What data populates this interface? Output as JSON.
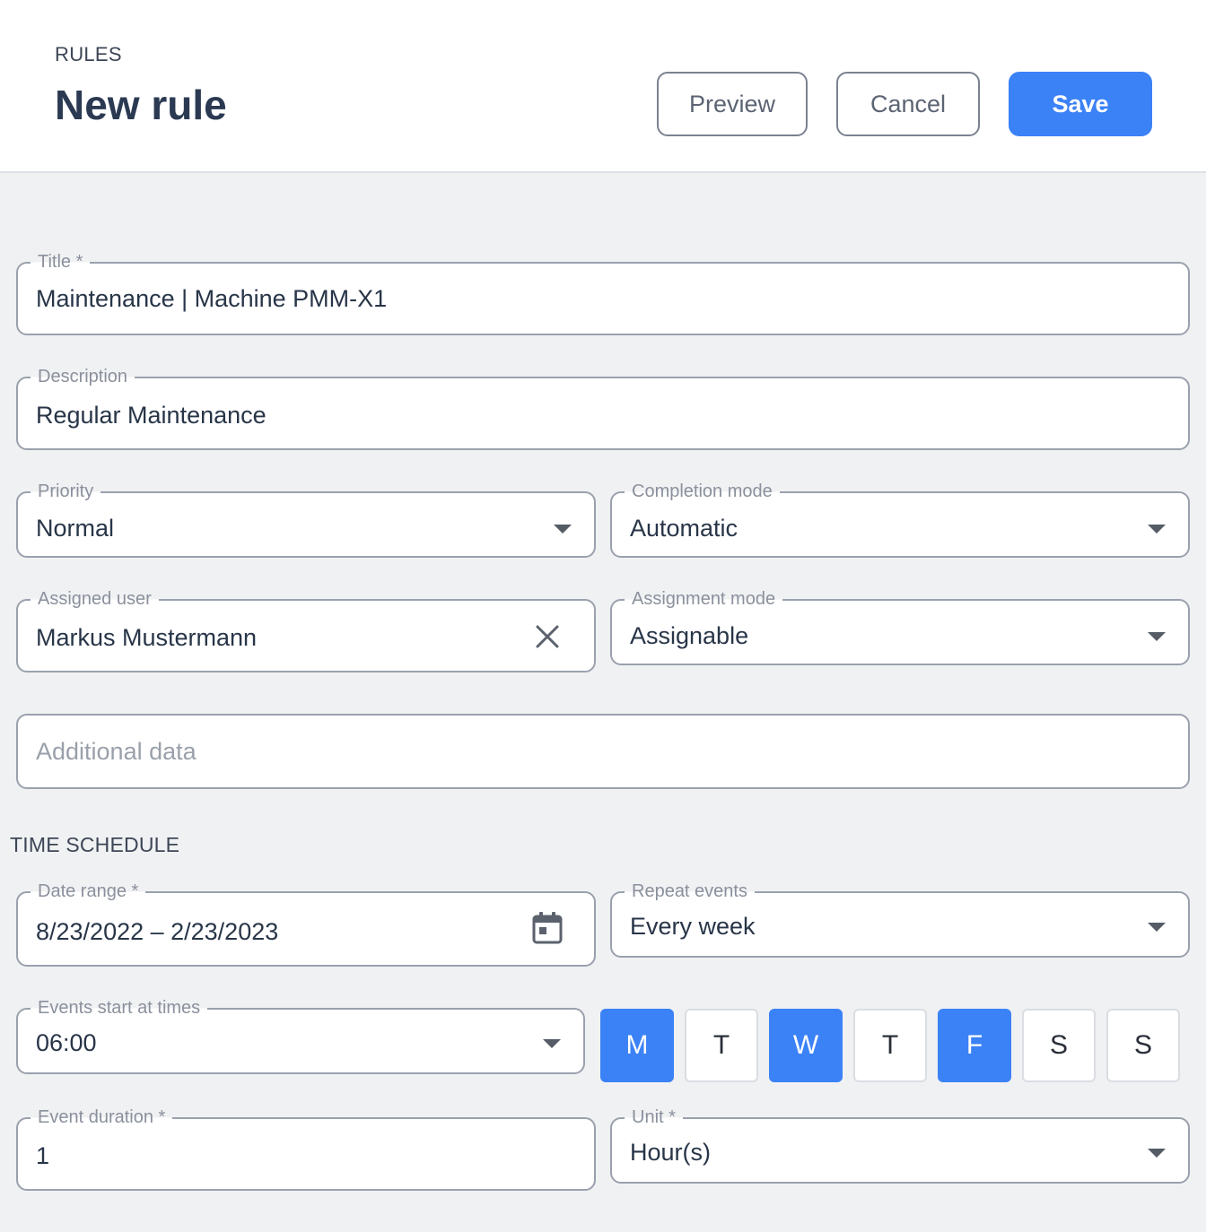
{
  "header": {
    "breadcrumb": "RULES",
    "title": "New rule",
    "preview_label": "Preview",
    "cancel_label": "Cancel",
    "save_label": "Save"
  },
  "form": {
    "title": {
      "label": "Title *",
      "value": "Maintenance | Machine PMM-X1"
    },
    "description": {
      "label": "Description",
      "value": "Regular Maintenance"
    },
    "priority": {
      "label": "Priority",
      "value": "Normal"
    },
    "completion_mode": {
      "label": "Completion mode",
      "value": "Automatic"
    },
    "assigned_user": {
      "label": "Assigned user",
      "value": "Markus Mustermann"
    },
    "assignment_mode": {
      "label": "Assignment mode",
      "value": "Assignable"
    },
    "additional_data": {
      "placeholder": "Additional data"
    }
  },
  "schedule": {
    "section_title": "TIME SCHEDULE",
    "date_range": {
      "label": "Date range *",
      "value": "8/23/2022 – 2/23/2023"
    },
    "repeat_events": {
      "label": "Repeat events",
      "value": "Every week"
    },
    "start_times": {
      "label": "Events start at times",
      "value": "06:00"
    },
    "days": [
      {
        "label": "M",
        "selected": true
      },
      {
        "label": "T",
        "selected": false
      },
      {
        "label": "W",
        "selected": true
      },
      {
        "label": "T",
        "selected": false
      },
      {
        "label": "F",
        "selected": true
      },
      {
        "label": "S",
        "selected": false
      },
      {
        "label": "S",
        "selected": false
      }
    ],
    "event_duration": {
      "label": "Event duration *",
      "value": "1"
    },
    "unit": {
      "label": "Unit *",
      "value": "Hour(s)"
    }
  },
  "icons": {
    "clear": "close-icon",
    "calendar": "calendar-icon",
    "dropdown": "chevron-down-icon"
  },
  "colors": {
    "primary": "#3b82f6",
    "border": "#9aa1ad",
    "background": "#f0f1f3"
  }
}
